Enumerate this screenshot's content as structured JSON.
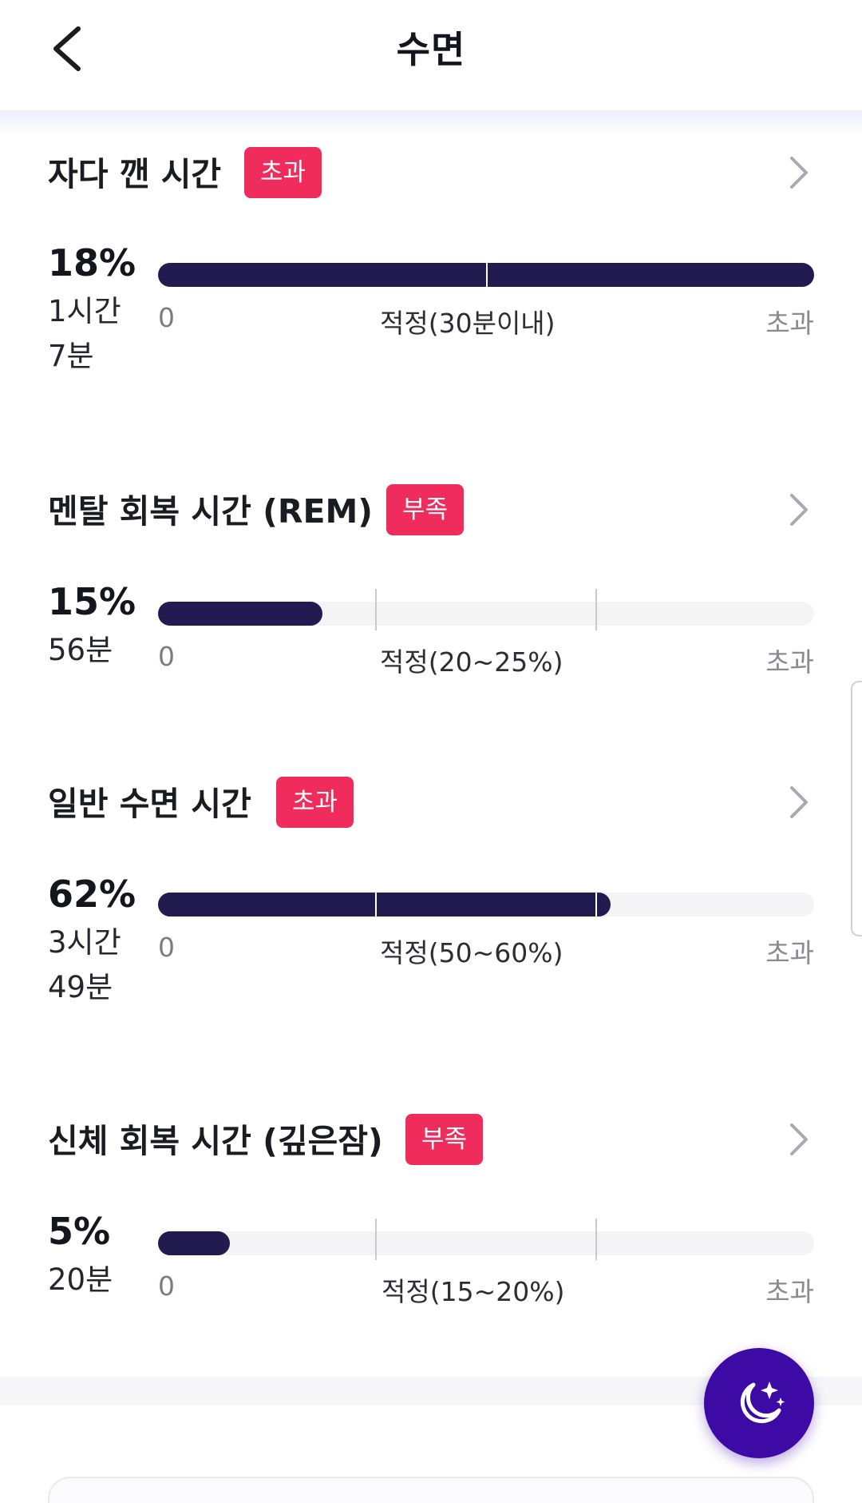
{
  "header": {
    "title": "수면",
    "back_icon": "chevron-left-icon"
  },
  "sections": [
    {
      "title": "자다 깬 시간",
      "badge": "초과",
      "percent": "18%",
      "duration_line1": "1시간",
      "duration_line2": "7분",
      "bar_fill_fraction": 1.0,
      "axis_zero": "0",
      "axis_range": "적정(30분이내)",
      "axis_over": "초과"
    },
    {
      "title": "멘탈 회복 시간 (REM)",
      "badge": "부족",
      "percent": "15%",
      "duration_line1": "56분",
      "duration_line2": "",
      "bar_fill_fraction": 0.25,
      "axis_zero": "0",
      "axis_range": "적정(20~25%)",
      "axis_over": "초과"
    },
    {
      "title": "일반 수면 시간",
      "badge": "초과",
      "percent": "62%",
      "duration_line1": "3시간",
      "duration_line2": "49분",
      "bar_fill_fraction": 0.69,
      "axis_zero": "0",
      "axis_range": "적정(50~60%)",
      "axis_over": "초과"
    },
    {
      "title": "신체 회복 시간 (깊은잠)",
      "badge": "부족",
      "percent": "5%",
      "duration_line1": "20분",
      "duration_line2": "",
      "bar_fill_fraction": 0.11,
      "axis_zero": "0",
      "axis_range": "적정(15~20%)",
      "axis_over": "초과"
    }
  ],
  "fab": {
    "icon": "moon-sparkle-icon"
  },
  "colors": {
    "badge": "#ef2c5b",
    "bar_fill": "#211b4f",
    "bar_track": "#f4f4f6",
    "fab": "#3d0aa6"
  }
}
